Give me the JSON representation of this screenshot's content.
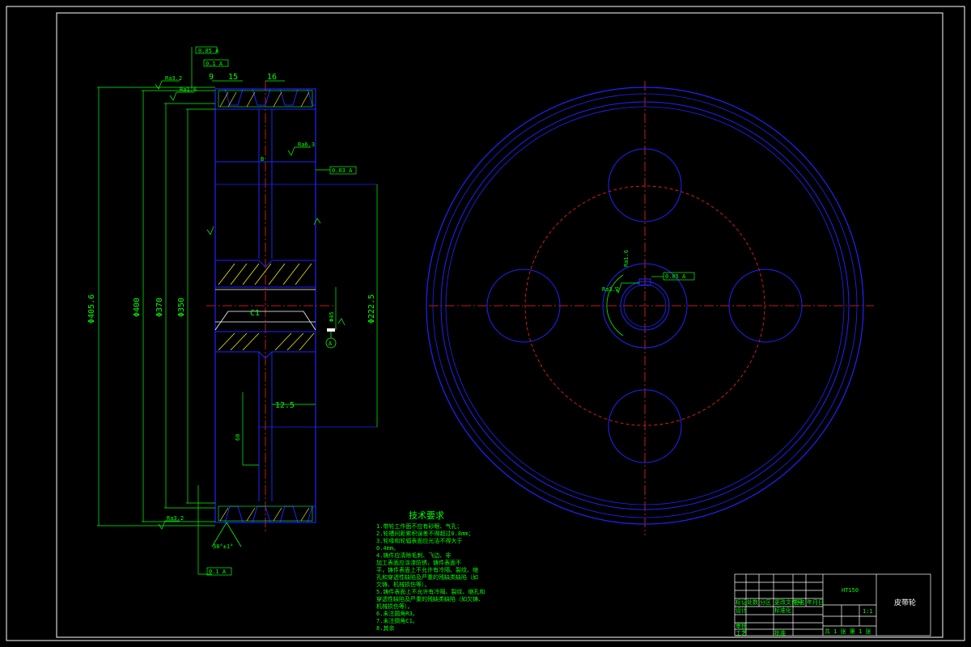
{
  "drawing": {
    "part_name": "皮带轮",
    "material": "HT150",
    "colors": {
      "background": "#000000",
      "frame": "#ffffff",
      "outline": "#2222ff",
      "dimension": "#00ff00",
      "centerline": "#ff2222"
    }
  },
  "section_view": {
    "dim_top_left": "9",
    "dim_top_right": "15",
    "dim_groove": "16",
    "dim_outer": "Φ405.6",
    "dim_d400": "Φ400",
    "dim_d370": "Φ370",
    "dim_d350": "Φ350",
    "dim_bore_hub": "Φ222.5",
    "dim_bore": "Φ45",
    "dim_keyway": "12.5",
    "dim_hub_len": "60",
    "chamfer": "C1",
    "groove_angle": "38°±1°",
    "datum": "A",
    "roughness_1": "Ra3.2",
    "roughness_2": "Ra1.6",
    "roughness_3": "Ra6.3",
    "tol_1": "0.05 A",
    "tol_2": "0.1 A",
    "tol_3": "0.03 A"
  },
  "tech_requirements": {
    "heading": "技术要求",
    "lines": [
      "1.带轮工作面不应有砂眼、气孔；",
      "2.轮槽间距累积误差不得超过0.8mm；",
      "3.轮缘和轮辐表面应光洁不得大于",
      "  0.4mm。",
      "4.铸件应清除毛刺、飞边、非",
      "加工表面应涂漆防锈，铸件表面不",
      "平，铸件表面上不允许有冷隔、裂纹、缩",
      "孔和穿透性缺陷及严重的残缺类缺陷（如",
      "欠铸、机械损伤等）。",
      "5.铸件表面上不允许有冷隔、裂纹、缩孔和",
      "穿透性缺陷及严重的残缺类缺陷（如欠铸、",
      "机械损伤等）。",
      "6.未注圆角R3。",
      "7.未注倒角C1。",
      "8.其余"
    ]
  },
  "title_block": {
    "material_label": "HT150",
    "part_label": "皮带轮",
    "scale": "1:1",
    "sheet": "共 1 张 第 1 张",
    "row_labels": [
      "标记",
      "处数",
      "分区",
      "更改文件号",
      "签名",
      "年月日"
    ],
    "design_label": "设计",
    "check_label": "审核",
    "process_label": "工艺",
    "approve_label": "批准",
    "std_label": "标准化"
  }
}
